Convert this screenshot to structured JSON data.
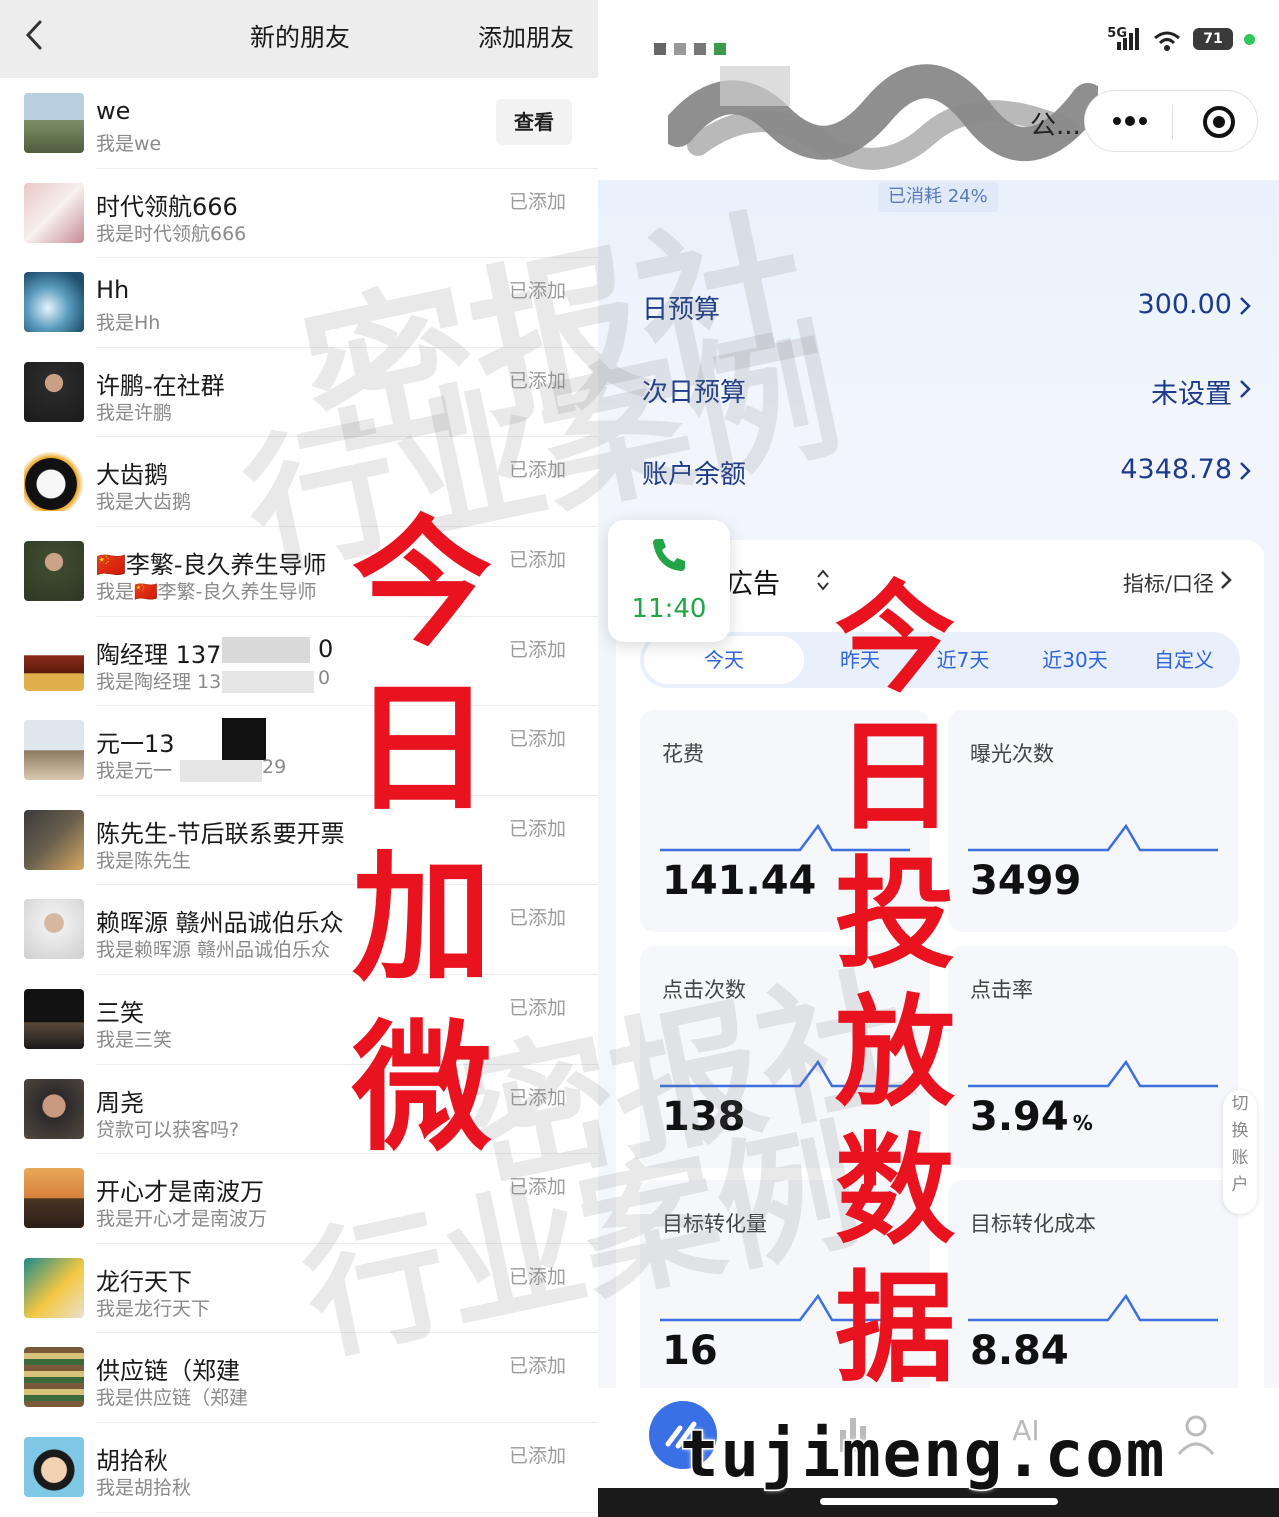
{
  "left": {
    "header": {
      "title": "新的朋友",
      "add_label": "添加朋友"
    },
    "view_label": "查看",
    "friends": [
      {
        "name": "we",
        "msg": "我是we",
        "status": ""
      },
      {
        "name": "时代领航666",
        "msg": "我是时代领航666",
        "status": "已添加"
      },
      {
        "name": "Hh",
        "msg": "我是Hh",
        "status": "已添加"
      },
      {
        "name": "许鹏-在社群",
        "msg": "我是许鹏",
        "status": "已添加"
      },
      {
        "name": "大齿鹅",
        "msg": "我是大齿鹅",
        "status": "已添加"
      },
      {
        "name": "🇨🇳李繁-良久养生导师",
        "msg": "我是🇨🇳李繁-良久养生导师",
        "status": "已添加"
      },
      {
        "name": "陶经理 137",
        "msg": "我是陶经理 13",
        "status": "已添加"
      },
      {
        "name": "元一13",
        "msg": "我是元一",
        "status": "已添加"
      },
      {
        "name": "陈先生-节后联系要开票",
        "msg": "我是陈先生",
        "status": "已添加"
      },
      {
        "name": "赖晖源  赣州品诚伯乐众",
        "msg": "我是赖晖源  赣州品诚伯乐众",
        "status": "已添加"
      },
      {
        "name": "三笑",
        "msg": "我是三笑",
        "status": "已添加"
      },
      {
        "name": "周尧",
        "msg": "贷款可以获客吗?",
        "status": "已添加"
      },
      {
        "name": "开心才是南波万",
        "msg": "我是开心才是南波万",
        "status": "已添加"
      },
      {
        "name": "龙行天下",
        "msg": "我是龙行天下",
        "status": "已添加"
      },
      {
        "name": "供应链（郑建",
        "msg": "我是供应链（郑建",
        "status": "已添加"
      },
      {
        "name": "胡拾秋",
        "msg": "我是胡拾秋",
        "status": "已添加"
      }
    ],
    "partial_tail_1": "0",
    "partial_tail_2": "0",
    "partial_tail_3": "29"
  },
  "right": {
    "status_bar": {
      "network": "5G",
      "battery": "71"
    },
    "title_truncated": "公...",
    "consumed": "已消耗 24%",
    "budget_rows": [
      {
        "label": "日预算",
        "value": "300.00"
      },
      {
        "label": "次日预算",
        "value": "未设置"
      },
      {
        "label": "账户余额",
        "value": "4348.78"
      }
    ],
    "section": {
      "title": "広告",
      "metric_label": "指标/口径"
    },
    "tabs": [
      "今天",
      "昨天",
      "近7天",
      "近30天",
      "自定义"
    ],
    "metrics": [
      {
        "label": "花费",
        "value": "141.44",
        "unit": ""
      },
      {
        "label": "曝光次数",
        "value": "3499",
        "unit": ""
      },
      {
        "label": "点击次数",
        "value": "138",
        "unit": ""
      },
      {
        "label": "点击率",
        "value": "3.94",
        "unit": "%"
      },
      {
        "label": "目标转化量",
        "value": "16",
        "unit": ""
      },
      {
        "label": "目标转化成本",
        "value": "8.84",
        "unit": ""
      }
    ],
    "call": {
      "time": "11:40"
    },
    "switch_account": [
      "切",
      "换",
      "账",
      "户"
    ],
    "tabbar_ai": "AI"
  },
  "overlay": {
    "left_big": [
      "今",
      "日",
      "加",
      "微"
    ],
    "right_big": [
      "今",
      "日",
      "投",
      "放",
      "数",
      "据"
    ],
    "watermark_1": "密报社",
    "watermark_2": "行业案例",
    "brand": "tujimeng.com"
  },
  "colors": {
    "accent_red": "#e8131f",
    "primary_blue": "#2f63d9",
    "call_green": "#22a447",
    "trend_line": "#3d6fde"
  }
}
